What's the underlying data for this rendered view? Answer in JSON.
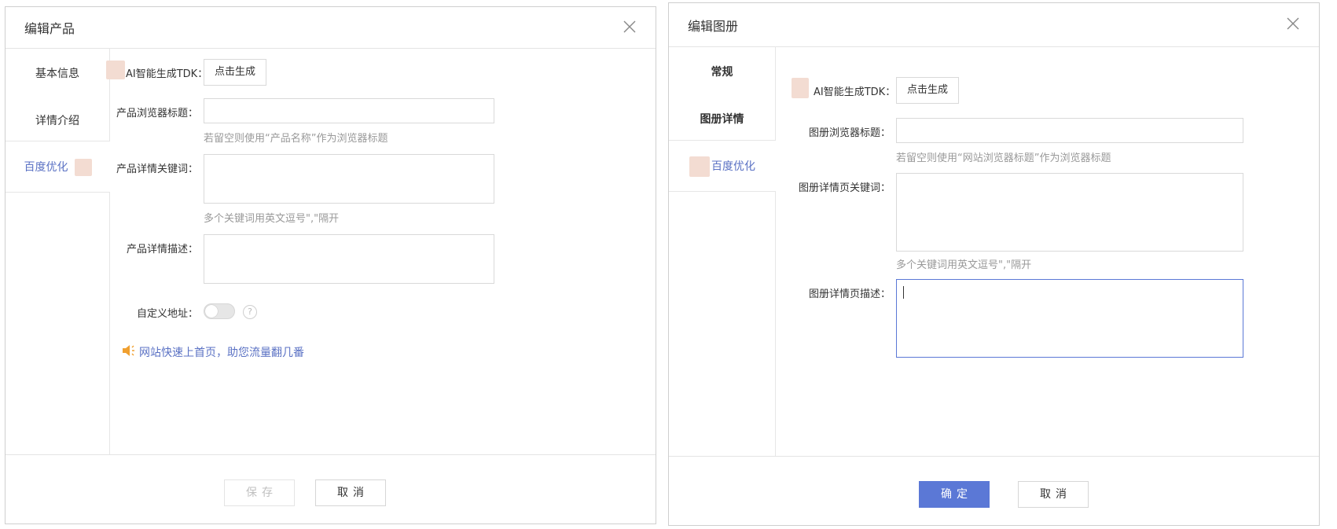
{
  "dialog1": {
    "title": "编辑产品",
    "tabs": [
      "基本信息",
      "详情介绍",
      "百度优化"
    ],
    "ai_label": "AI智能生成TDK：",
    "generate_button": "点击生成",
    "browser_title_label": "产品浏览器标题：",
    "browser_title_hint": "若留空则使用“产品名称”作为浏览器标题",
    "keywords_label": "产品详情关键词：",
    "keywords_hint": "多个关键词用英文逗号\",\"隔开",
    "description_label": "产品详情描述：",
    "custom_url_label": "自定义地址：",
    "custom_url_enabled": false,
    "help_glyph": "?",
    "promo_text": "网站快速上首页，助您流量翻几番",
    "save_button": "保存",
    "cancel_button": "取消"
  },
  "dialog2": {
    "title": "编辑图册",
    "tabs": [
      "常规",
      "图册详情",
      "百度优化"
    ],
    "ai_label": "AI智能生成TDK：",
    "generate_button": "点击生成",
    "browser_title_label": "图册浏览器标题：",
    "browser_title_hint": "若留空则使用“网站浏览器标题”作为浏览器标题",
    "keywords_label": "图册详情页关键词：",
    "keywords_hint": "多个关键词用英文逗号\",\"隔开",
    "description_label": "图册详情页描述：",
    "confirm_button": "确定",
    "cancel_button": "取消"
  },
  "colors": {
    "accent": "#5b78d6",
    "link": "#5b72c4",
    "promo_icon": "#f0a030"
  }
}
